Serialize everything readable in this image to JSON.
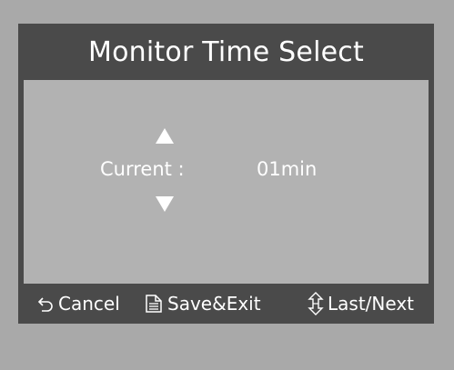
{
  "dialog": {
    "title": "Monitor Time Select"
  },
  "field": {
    "label": "Current :",
    "value": "01min"
  },
  "footer": {
    "cancel_label": "Cancel",
    "save_label": "Save&Exit",
    "next_label": "Last/Next"
  },
  "icons": {
    "cancel": "undo-arrow-icon",
    "save": "document-icon",
    "next": "up-down-arrow-icon",
    "increase": "triangle-up-icon",
    "decrease": "triangle-down-icon"
  },
  "colors": {
    "outer_background": "#a9a9a9",
    "dialog_frame": "#4a4a4a",
    "content_background": "#b2b2b2",
    "text": "#ffffff"
  }
}
